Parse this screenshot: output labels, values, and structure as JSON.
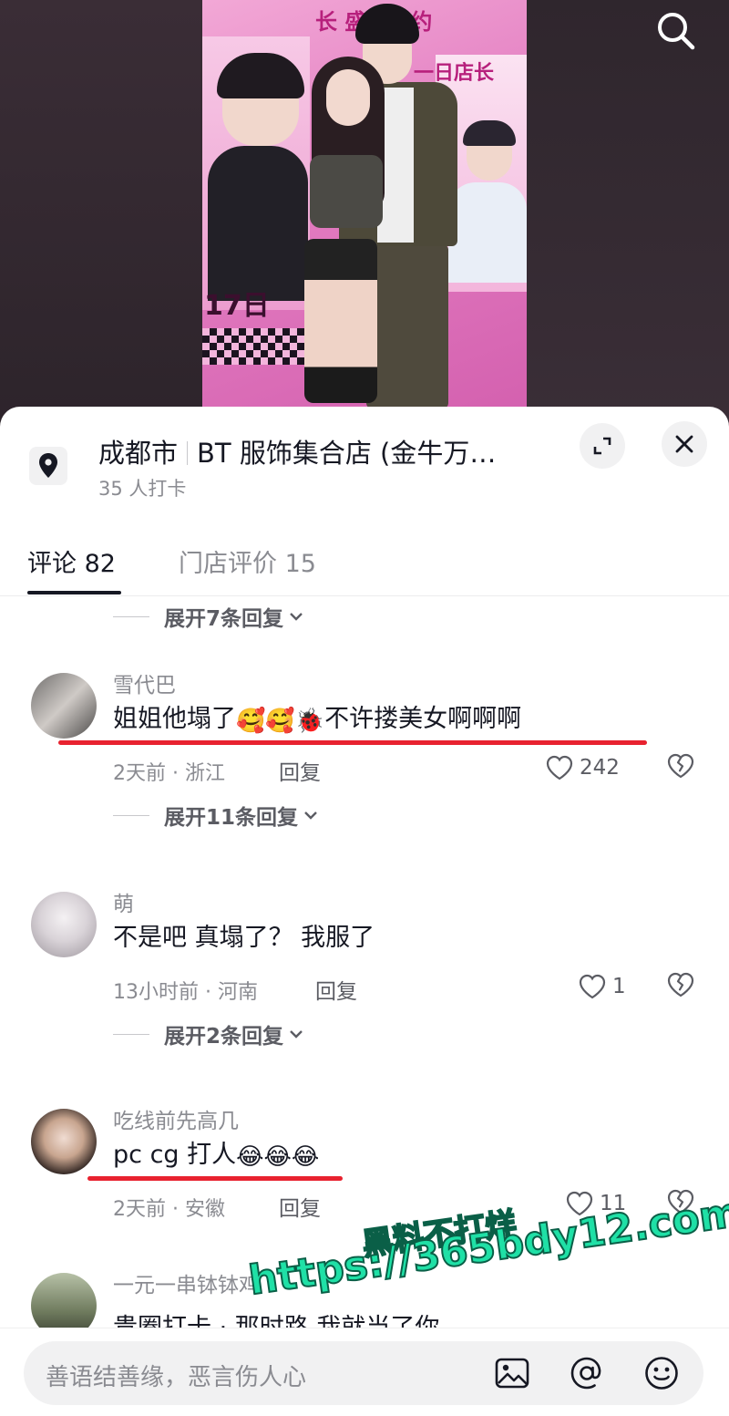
{
  "photo": {
    "poster_title_top": "长   盛夏携约",
    "poster_sub": "一日店长",
    "poster_date": "17日"
  },
  "header": {
    "city": "成都市",
    "store": "BT 服饰集合店 (金牛万…",
    "checkins": "35 人打卡"
  },
  "tabs": [
    {
      "label": "评论 82",
      "active": true
    },
    {
      "label": "门店评价 15",
      "active": false
    }
  ],
  "top_expand": {
    "label": "展开7条回复"
  },
  "comments": [
    {
      "username": "雪代巴",
      "text": "姐姐他塌了",
      "emojis": [
        "🥰",
        "🥰",
        "🐞"
      ],
      "text_suffix": "不许搂美女啊啊啊",
      "time": "2天前 · 浙江",
      "reply_label": "回复",
      "likes": "242",
      "expand_label": "展开11条回复",
      "underlined": true
    },
    {
      "username": "萌",
      "text": "不是吧 真塌了？ 我服了",
      "emojis": [],
      "text_suffix": "",
      "time": "13小时前 · 河南",
      "reply_label": "回复",
      "likes": "1",
      "expand_label": "展开2条回复",
      "underlined": false
    },
    {
      "username": "吃线前先高几",
      "text": "pc cg 打人",
      "emojis": [
        "😂",
        "😂",
        "😂"
      ],
      "text_suffix": "",
      "time": "2天前 · 安徽",
      "reply_label": "回复",
      "likes": "11",
      "expand_label": "",
      "underlined": true
    },
    {
      "username": "一元一串钵钵鸡",
      "text": "贵圈打卡 · 那时路    我就当了你",
      "emojis": [],
      "text_suffix": "",
      "time": "",
      "reply_label": "",
      "likes": "",
      "expand_label": "",
      "underlined": false
    }
  ],
  "watermark": {
    "line1": "黑料不打烊",
    "line2": "https://365bdy12.com"
  },
  "input": {
    "placeholder": "善语结善缘，恶言伤人心"
  },
  "colors": {
    "accent_red": "#e8222f",
    "watermark_green": "#1fe0a6",
    "text_primary": "#161823",
    "text_secondary": "#8a8b91"
  },
  "icons": [
    "search-icon",
    "location-pin-icon",
    "expand-icon",
    "close-icon",
    "chevron-down-icon",
    "heart-icon",
    "broken-heart-icon",
    "image-icon",
    "at-icon",
    "emoji-icon"
  ]
}
